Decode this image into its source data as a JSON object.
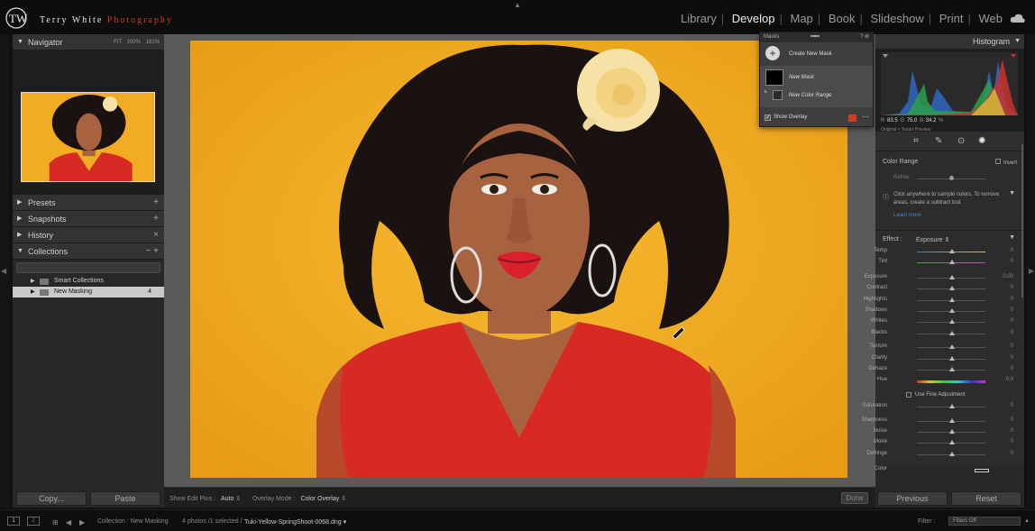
{
  "brand": {
    "first": "Terry White",
    "second": "Photography",
    "monogram": "TW"
  },
  "modules": [
    "Library",
    "Develop",
    "Map",
    "Book",
    "Slideshow",
    "Print",
    "Web"
  ],
  "active_module": "Develop",
  "left_panel": {
    "navigator": {
      "title": "Navigator",
      "zoom": [
        "FIT",
        "100%",
        "181%"
      ]
    },
    "presets": "Presets",
    "snapshots": "Snapshots",
    "history": "History",
    "collections": {
      "title": "Collections",
      "items": [
        {
          "label": "Smart Collections",
          "count": ""
        },
        {
          "label": "New Masking",
          "count": "4"
        }
      ]
    },
    "copy": "Copy...",
    "paste": "Paste"
  },
  "toolbar": {
    "show_edit_pins_label": "Show Edit Pins :",
    "show_edit_pins_value": "Auto",
    "overlay_mode_label": "Overlay Mode :",
    "overlay_mode_value": "Color Overlay",
    "done": "Done"
  },
  "masks_panel": {
    "title": "Masks",
    "create_new_mask": "Create New Mask",
    "mask_name": "New Mask",
    "component": "New Color Range",
    "show_overlay": "Show Overlay",
    "overlay_color": "#d33b20"
  },
  "right_panel": {
    "histogram_title": "Histogram",
    "rgb": {
      "r_label": "R",
      "r": "83.5",
      "g_label": "G",
      "g": "75.0",
      "b_label": "B",
      "b": "34.2",
      "unit": "%"
    },
    "preview_label": "Original + Smart Preview",
    "color_range_label": "Color Range",
    "invert_label": "Invert",
    "refine_label": "Refine",
    "help_text": "Click anywhere to sample colors. To remove areas, create a subtract tool.",
    "learn_more": "Learn more",
    "effect_label": "Effect :",
    "effect_value": "Exposure",
    "sliders_a": [
      {
        "label": "Temp",
        "value": "0"
      },
      {
        "label": "Tint",
        "value": "0"
      }
    ],
    "sliders_b": [
      {
        "label": "Exposure",
        "value": "0.00"
      },
      {
        "label": "Contrast",
        "value": "0"
      },
      {
        "label": "Highlights",
        "value": "0"
      },
      {
        "label": "Shadows",
        "value": "0"
      },
      {
        "label": "Whites",
        "value": "0"
      },
      {
        "label": "Blacks",
        "value": "0"
      }
    ],
    "sliders_c": [
      {
        "label": "Texture",
        "value": "0"
      },
      {
        "label": "Clarity",
        "value": "0"
      },
      {
        "label": "Dehaze",
        "value": "0"
      }
    ],
    "hue_label": "Hue",
    "hue_value": "0.0",
    "fine_adjust_label": "Use Fine Adjustment",
    "sliders_d": [
      {
        "label": "Saturation",
        "value": "0"
      }
    ],
    "sliders_e": [
      {
        "label": "Sharpness",
        "value": "0"
      },
      {
        "label": "Noise",
        "value": "0"
      },
      {
        "label": "Moiré",
        "value": "0"
      },
      {
        "label": "Defringe",
        "value": "0"
      }
    ],
    "color_label": "Color",
    "previous": "Previous",
    "reset": "Reset"
  },
  "filmstrip": {
    "view1": "1",
    "view2": "2",
    "source": "Collection : New Masking",
    "count": "4 photos /1 selected /",
    "filename": "Tuki-Yellow-SpringShoot-0068.dng",
    "filter_label": "Filter :",
    "filter_value": "Filters Off"
  },
  "colors": {
    "background_yellow": "#f2ac22",
    "dress_red": "#d82a24",
    "skin": "#a7623f",
    "hair": "#1a1210",
    "flower": "#f6e2a6"
  }
}
